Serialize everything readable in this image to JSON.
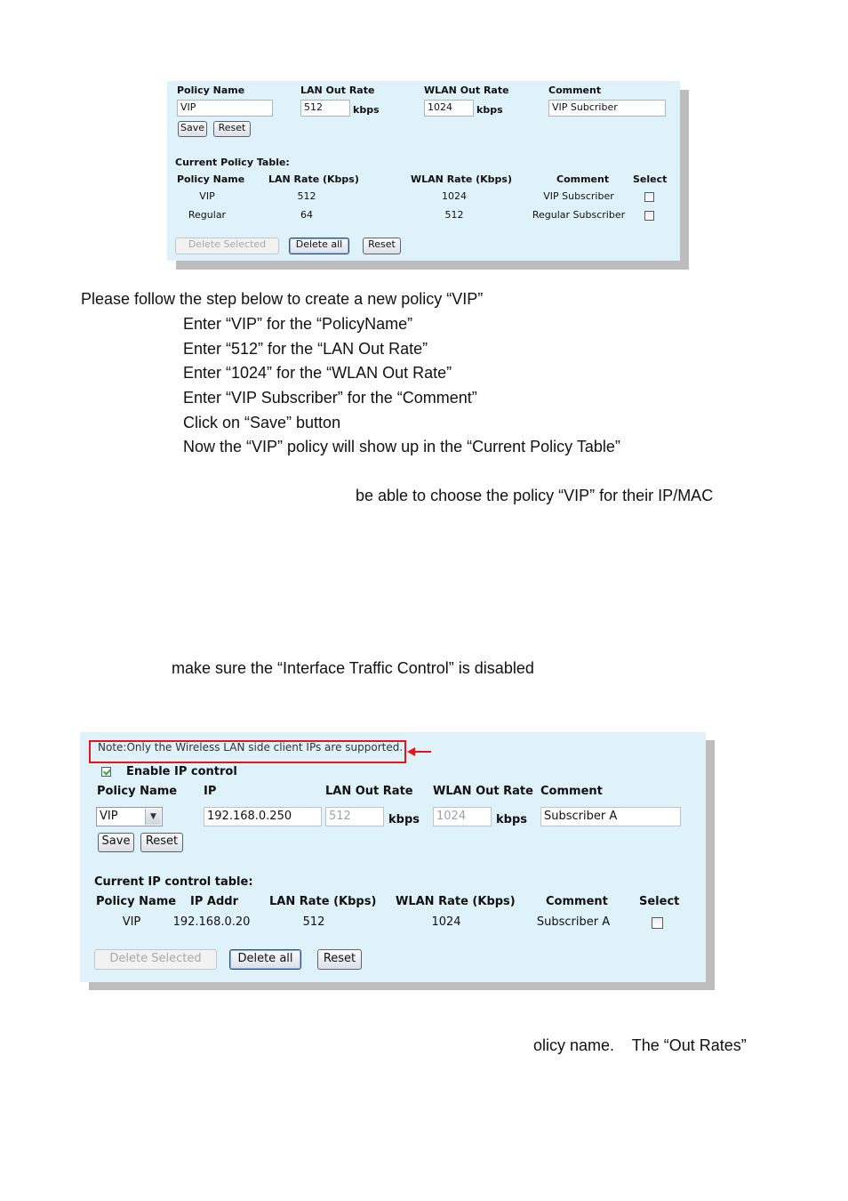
{
  "policy_panel": {
    "form": {
      "policy_name_label": "Policy Name",
      "lan_out_rate_label": "LAN Out Rate",
      "wlan_out_rate_label": "WLAN Out Rate",
      "comment_label": "Comment",
      "policy_name_value": "VIP",
      "lan_out_rate_value": "512",
      "wlan_out_rate_value": "1024",
      "comment_value": "VIP Subcriber",
      "unit": "kbps",
      "save_label": "Save",
      "reset_label": "Reset"
    },
    "table": {
      "title": "Current Policy Table:",
      "headers": [
        "Policy Name",
        "LAN Rate (Kbps)",
        "WLAN Rate (Kbps)",
        "Comment",
        "Select"
      ],
      "rows": [
        {
          "policy": "VIP",
          "lan": "512",
          "wlan": "1024",
          "comment": "VIP Subscriber",
          "selected": false
        },
        {
          "policy": "Regular",
          "lan": "64",
          "wlan": "512",
          "comment": "Regular Subscriber",
          "selected": false
        }
      ],
      "delete_selected_label": "Delete Selected",
      "delete_all_label": "Delete all",
      "reset_label": "Reset"
    }
  },
  "instructions": {
    "intro": "Please follow the step below to create a new policy “VIP”",
    "steps": [
      "Enter “VIP” for the “PolicyName”",
      "Enter “512” for the “LAN Out Rate”",
      "Enter “1024” for the “WLAN Out Rate”",
      "Enter “VIP Subscriber” for the “Comment”",
      "Click on “Save” button",
      "Now the “VIP” policy will show up in the “Current Policy Table”"
    ],
    "fragment_choose": "be able to choose the policy “VIP” for their IP/MAC",
    "fragment_disabled": "make sure the “Interface Traffic Control” is disabled",
    "fragment_out_rates": "olicy name.    The “Out Rates”"
  },
  "ip_panel": {
    "note": "Note:Only the Wireless LAN side client IPs are supported.",
    "enable_label": "Enable IP control",
    "enable_checked": true,
    "form": {
      "policy_name_label": "Policy Name",
      "ip_label": "IP",
      "lan_out_rate_label": "LAN Out Rate",
      "wlan_out_rate_label": "WLAN Out Rate",
      "comment_label": "Comment",
      "policy_selected": "VIP",
      "ip_value": "192.168.0.250",
      "lan_out_rate_value": "512",
      "wlan_out_rate_value": "1024",
      "comment_value": "Subscriber A",
      "unit": "kbps",
      "save_label": "Save",
      "reset_label": "Reset"
    },
    "table": {
      "title": "Current IP control table:",
      "headers": [
        "Policy Name",
        "IP Addr",
        "LAN Rate (Kbps)",
        "WLAN Rate (Kbps)",
        "Comment",
        "Select"
      ],
      "rows": [
        {
          "policy": "VIP",
          "ip": "192.168.0.20",
          "lan": "512",
          "wlan": "1024",
          "comment": "Subscriber A",
          "selected": false
        }
      ],
      "delete_selected_label": "Delete Selected",
      "delete_all_label": "Delete all",
      "reset_label": "Reset"
    },
    "highlight_color": "#e8141c"
  },
  "colors": {
    "panel_bg": "#dff2fa",
    "shadow": "#bdbdbd"
  }
}
